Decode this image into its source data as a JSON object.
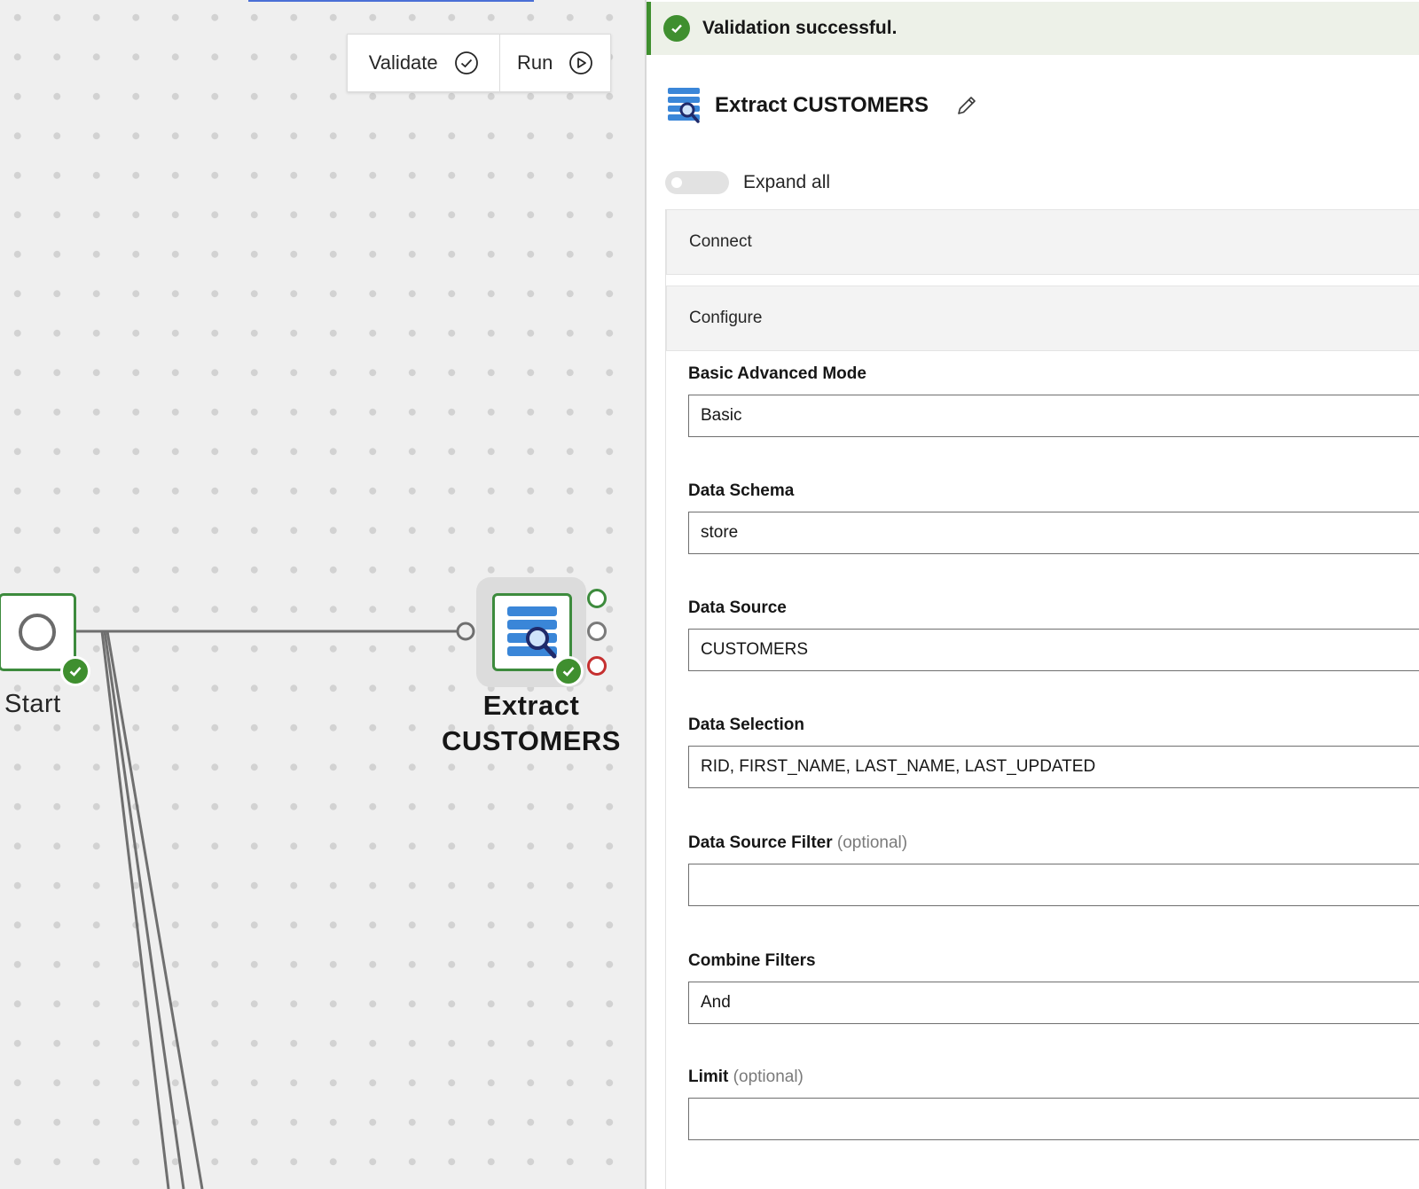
{
  "toolbar": {
    "validate_label": "Validate",
    "run_label": "Run"
  },
  "flow": {
    "start_label": "Start",
    "extract_label_line1": "Extract",
    "extract_label_line2": "CUSTOMERS",
    "status_color_ok": "#3f8f2f",
    "status_color_error": "#c53030"
  },
  "panel": {
    "banner_text": "Validation successful.",
    "title": "Extract CUSTOMERS",
    "expand_all_label": "Expand all",
    "expand_all_on": false,
    "sections": {
      "connect": "Connect",
      "configure": "Configure"
    },
    "fields": {
      "mode": {
        "label": "Basic Advanced Mode",
        "value": "Basic"
      },
      "schema": {
        "label": "Data Schema",
        "value": "store"
      },
      "source": {
        "label": "Data Source",
        "value": "CUSTOMERS"
      },
      "selection": {
        "label": "Data Selection",
        "value": "RID, FIRST_NAME, LAST_NAME, LAST_UPDATED"
      },
      "filter": {
        "label": "Data Source Filter",
        "optional": "(optional)",
        "value": ""
      },
      "combine": {
        "label": "Combine Filters",
        "value": "And"
      },
      "limit": {
        "label": "Limit",
        "optional": "(optional)",
        "value": ""
      }
    }
  },
  "icons": {
    "validate": "check-circle-icon",
    "run": "play-circle-icon",
    "edit": "pencil-icon",
    "node": "database-search-icon"
  }
}
